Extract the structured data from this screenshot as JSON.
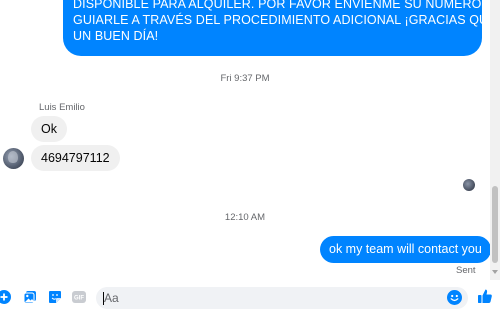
{
  "thread": {
    "outgoing_top_lines": [
      "DISPONIBLE PARA ALQUILER. POR FAVOR ENVIÉNME SU NÚMERO PARA",
      "GUIARLE A TRAVÉS DEL PROCEDIMIENTO ADICIONAL ¡GRACIAS QUE TENGA",
      "UN BUEN DÍA!"
    ],
    "timestamp_1": "Fri 9:37 PM",
    "sender_name": "Luis Emilio",
    "incoming_1": "Ok",
    "incoming_2": "4694797112",
    "timestamp_2": "12:10 AM",
    "outgoing_last": "ok my team will contact you",
    "status": "Sent"
  },
  "composer": {
    "placeholder": "Aa",
    "icons": [
      "plus-icon",
      "photo-icon",
      "sticker-icon",
      "gif-icon",
      "emoji-icon",
      "thumbs-up-icon"
    ],
    "gif_label": "GIF"
  },
  "colors": {
    "accent": "#0084ff",
    "incoming_bubble": "#f0f0f0",
    "meta_text": "#65676b"
  }
}
